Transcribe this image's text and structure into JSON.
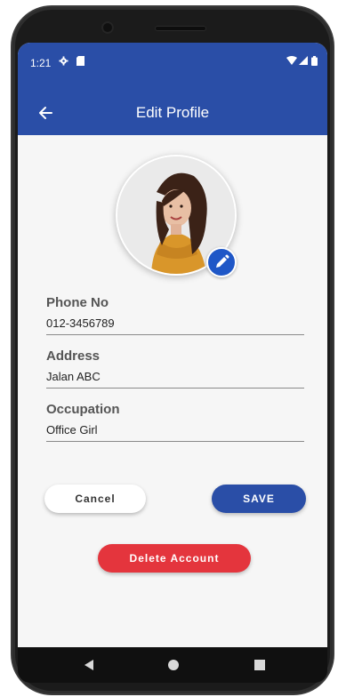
{
  "status_bar": {
    "time": "1:21",
    "icons": [
      "settings-icon",
      "sim-card-icon",
      "wifi-icon",
      "signal-icon",
      "battery-icon"
    ]
  },
  "app_bar": {
    "title": "Edit Profile",
    "back_icon": "arrow-back-icon"
  },
  "profile": {
    "edit_icon": "pencil-icon"
  },
  "fields": {
    "phone": {
      "label": "Phone No",
      "value": "012-3456789"
    },
    "address": {
      "label": "Address",
      "value": "Jalan ABC"
    },
    "occupation": {
      "label": "Occupation",
      "value": "Office Girl"
    }
  },
  "buttons": {
    "cancel": "Cancel",
    "save": "SAVE",
    "delete": "Delete Account"
  },
  "nav_bar": {
    "icons": [
      "back-triangle-icon",
      "home-circle-icon",
      "recents-square-icon"
    ]
  },
  "colors": {
    "primary": "#2a4ea7",
    "danger": "#e4353d",
    "edit_badge": "#1f57c7",
    "background": "#f6f6f6"
  }
}
